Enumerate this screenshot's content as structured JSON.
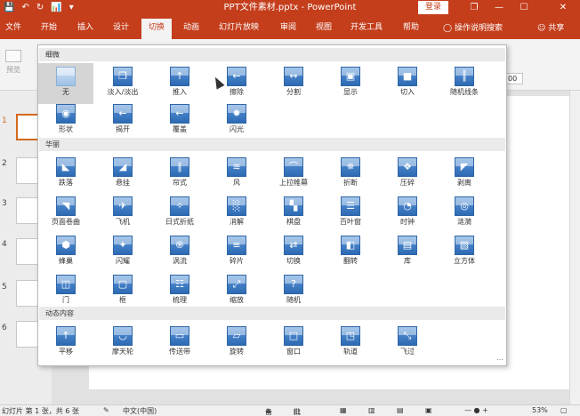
{
  "titlebar": {
    "qat_save": "💾",
    "qat_undo": "↶",
    "qat_redo": "↻",
    "qat_custom": "📊",
    "qat_more": "▾",
    "title": "PPT文件素材.pptx - PowerPoint",
    "login": "登录",
    "restore": "❐",
    "minimize": "—",
    "maximize": "☐",
    "close": "✕"
  },
  "tabs": [
    {
      "label": "文件"
    },
    {
      "label": "开始"
    },
    {
      "label": "插入"
    },
    {
      "label": "设计"
    },
    {
      "label": "切换"
    },
    {
      "label": "动画"
    },
    {
      "label": "幻灯片放映"
    },
    {
      "label": "审阅"
    },
    {
      "label": "视图"
    },
    {
      "label": "开发工具"
    },
    {
      "label": "帮助"
    }
  ],
  "tell_me": "操作说明搜索",
  "share": "共享",
  "ribbon": {
    "preview": "预览",
    "preview_group": "预览",
    "duration_partial": "00"
  },
  "gallery": {
    "sections": [
      {
        "label": "细微"
      },
      {
        "label": "华丽"
      },
      {
        "label": "动态内容"
      }
    ],
    "subtle": [
      {
        "label": "无",
        "icon": "none-icon",
        "glyph": ""
      },
      {
        "label": "淡入/淡出",
        "icon": "fade-icon",
        "glyph": "❐"
      },
      {
        "label": "推入",
        "icon": "push-icon",
        "glyph": "↑"
      },
      {
        "label": "擦除",
        "icon": "wipe-icon",
        "glyph": "←"
      },
      {
        "label": "分割",
        "icon": "split-icon",
        "glyph": "↔"
      },
      {
        "label": "显示",
        "icon": "reveal-icon",
        "glyph": "▣"
      },
      {
        "label": "切入",
        "icon": "cut-icon",
        "glyph": "■"
      },
      {
        "label": "随机线条",
        "icon": "random-bars-icon",
        "glyph": "║"
      },
      {
        "label": "形状",
        "icon": "shape-icon",
        "glyph": "◉"
      },
      {
        "label": "揭开",
        "icon": "uncover-icon",
        "glyph": "←"
      },
      {
        "label": "覆盖",
        "icon": "cover-icon",
        "glyph": "←"
      },
      {
        "label": "闪光",
        "icon": "flash-icon",
        "glyph": "✹"
      }
    ],
    "exciting": [
      {
        "label": "跌落",
        "icon": "fall-over-icon",
        "glyph": "◣"
      },
      {
        "label": "悬挂",
        "icon": "drape-icon",
        "glyph": "◢"
      },
      {
        "label": "帘式",
        "icon": "curtains-icon",
        "glyph": "∥"
      },
      {
        "label": "风",
        "icon": "wind-icon",
        "glyph": "≋"
      },
      {
        "label": "上拉帷幕",
        "icon": "prestige-icon",
        "glyph": "⌒"
      },
      {
        "label": "折断",
        "icon": "fracture-icon",
        "glyph": "✵"
      },
      {
        "label": "压碎",
        "icon": "crush-icon",
        "glyph": "❖"
      },
      {
        "label": "剥离",
        "icon": "peel-off-icon",
        "glyph": "◤"
      },
      {
        "label": "页面卷曲",
        "icon": "page-curl-icon",
        "glyph": "◥"
      },
      {
        "label": "飞机",
        "icon": "airplane-icon",
        "glyph": "✈"
      },
      {
        "label": "日式折纸",
        "icon": "origami-icon",
        "glyph": "✧"
      },
      {
        "label": "消解",
        "icon": "dissolve-icon",
        "glyph": "░"
      },
      {
        "label": "棋盘",
        "icon": "checkerboard-icon",
        "glyph": "▚"
      },
      {
        "label": "百叶窗",
        "icon": "blinds-icon",
        "glyph": "☰"
      },
      {
        "label": "时钟",
        "icon": "clock-icon",
        "glyph": "◔"
      },
      {
        "label": "涟漪",
        "icon": "ripple-icon",
        "glyph": "◎"
      },
      {
        "label": "蜂巢",
        "icon": "honeycomb-icon",
        "glyph": "⬢"
      },
      {
        "label": "闪耀",
        "icon": "glitter-icon",
        "glyph": "✦"
      },
      {
        "label": "涡流",
        "icon": "vortex-icon",
        "glyph": "֎"
      },
      {
        "label": "碎片",
        "icon": "shred-icon",
        "glyph": "≡"
      },
      {
        "label": "切换",
        "icon": "switch-icon",
        "glyph": "⇄"
      },
      {
        "label": "翻转",
        "icon": "flip-icon",
        "glyph": "◧"
      },
      {
        "label": "库",
        "icon": "gallery-icon",
        "glyph": "▤"
      },
      {
        "label": "立方体",
        "icon": "cube-icon",
        "glyph": "▧"
      },
      {
        "label": "门",
        "icon": "doors-icon",
        "glyph": "◫"
      },
      {
        "label": "框",
        "icon": "box-icon",
        "glyph": "▢"
      },
      {
        "label": "梳理",
        "icon": "comb-icon",
        "glyph": "☷"
      },
      {
        "label": "缩放",
        "icon": "zoom-icon",
        "glyph": "⤢"
      },
      {
        "label": "随机",
        "icon": "random-icon",
        "glyph": "?"
      }
    ],
    "dynamic": [
      {
        "label": "平移",
        "icon": "pan-icon",
        "glyph": "↑"
      },
      {
        "label": "摩天轮",
        "icon": "ferris-wheel-icon",
        "glyph": "◡"
      },
      {
        "label": "传送带",
        "icon": "conveyor-icon",
        "glyph": "▭"
      },
      {
        "label": "旋转",
        "icon": "rotate-icon",
        "glyph": "▱"
      },
      {
        "label": "窗口",
        "icon": "window-icon",
        "glyph": "□"
      },
      {
        "label": "轨道",
        "icon": "orbit-icon",
        "glyph": "◳"
      },
      {
        "label": "飞过",
        "icon": "fly-through-icon",
        "glyph": "⤡"
      }
    ]
  },
  "slides": [
    {
      "num": "1"
    },
    {
      "num": "2"
    },
    {
      "num": "3"
    },
    {
      "num": "4"
    },
    {
      "num": "5"
    },
    {
      "num": "6"
    }
  ],
  "status": {
    "slide_info": "幻灯片 第 1 张，共 6 张",
    "language": "中文(中国)",
    "notes": "备注",
    "comments": "批注",
    "zoom": "53%"
  },
  "colors": {
    "accent": "#c43e1c",
    "icon_blue": "#2d6ab4"
  }
}
